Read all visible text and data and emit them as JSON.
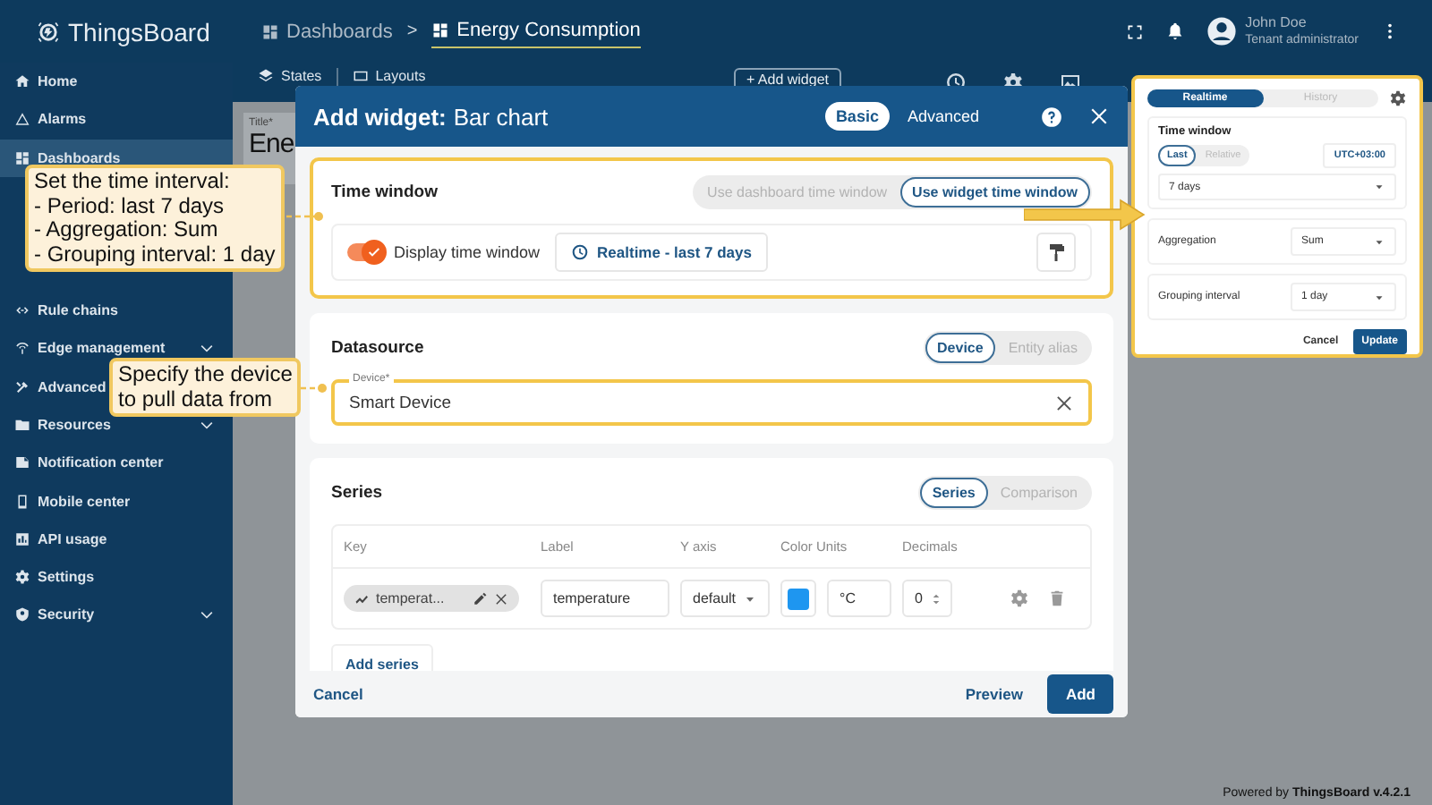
{
  "app": {
    "logo": "ThingsBoard",
    "breadcrumbs": [
      {
        "label": "Dashboards",
        "current": false
      },
      {
        "label": "Energy Consumption",
        "current": true
      }
    ],
    "separator": ">",
    "user": {
      "name": "John Doe",
      "role": "Tenant administrator"
    }
  },
  "sidebar": {
    "items": [
      {
        "label": "Home",
        "selected": false,
        "expandable": false
      },
      {
        "label": "Alarms",
        "selected": false,
        "expandable": false
      },
      {
        "label": "Dashboards",
        "selected": true,
        "expandable": false
      },
      {
        "label": "Rule chains",
        "selected": false,
        "expandable": false
      },
      {
        "label": "Edge management",
        "selected": false,
        "expandable": true
      },
      {
        "label": "Advanced",
        "selected": false,
        "expandable": false
      },
      {
        "label": "Resources",
        "selected": false,
        "expandable": true
      },
      {
        "label": "Notification center",
        "selected": false,
        "expandable": false
      },
      {
        "label": "Mobile center",
        "selected": false,
        "expandable": false
      },
      {
        "label": "API usage",
        "selected": false,
        "expandable": false
      },
      {
        "label": "Settings",
        "selected": false,
        "expandable": false
      },
      {
        "label": "Security",
        "selected": false,
        "expandable": true
      }
    ]
  },
  "toolbar": {
    "items": [
      "States",
      "Layouts"
    ],
    "add_widget": "+ Add widget"
  },
  "dashboard": {
    "title_label": "Title*",
    "title": "Ene"
  },
  "dialog": {
    "title": "Add widget:",
    "widget": "Bar chart",
    "modes": [
      {
        "label": "Basic",
        "selected": true
      },
      {
        "label": "Advanced",
        "selected": false
      }
    ],
    "time_window": {
      "heading": "Time window",
      "highlighted": true,
      "options": [
        {
          "label": "Use dashboard time window",
          "selected": false
        },
        {
          "label": "Use widget time window",
          "selected": true
        }
      ],
      "display_toggle": {
        "label": "Display time window",
        "on": true
      },
      "value": "Realtime - last 7 days"
    },
    "datasource": {
      "heading": "Datasource",
      "options": [
        {
          "label": "Device",
          "selected": true
        },
        {
          "label": "Entity alias",
          "selected": false
        }
      ],
      "device": {
        "label": "Device*",
        "value": "Smart Device",
        "highlighted": true
      }
    },
    "series": {
      "heading": "Series",
      "options": [
        {
          "label": "Series",
          "selected": true
        },
        {
          "label": "Comparison",
          "selected": false
        }
      ],
      "columns": [
        "Key",
        "Label",
        "Y axis",
        "Color",
        "Units",
        "Decimals"
      ],
      "rows": [
        {
          "key": "temperat...",
          "label": "temperature",
          "y_axis": "default",
          "color": "#1e96f0",
          "units": "°C",
          "decimals": "0"
        }
      ],
      "add": "Add series"
    },
    "buttons": {
      "cancel": "Cancel",
      "preview": "Preview",
      "add": "Add"
    }
  },
  "time_popup": {
    "tabs": [
      {
        "label": "Realtime",
        "selected": true
      },
      {
        "label": "History",
        "selected": false
      }
    ],
    "heading": "Time window",
    "modes": [
      {
        "label": "Last",
        "selected": true
      },
      {
        "label": "Relative",
        "selected": false
      }
    ],
    "timezone": "UTC+03:00",
    "period": "7 days",
    "aggregation": {
      "label": "Aggregation",
      "value": "Sum"
    },
    "grouping": {
      "label": "Grouping interval",
      "value": "1 day"
    },
    "cancel": "Cancel",
    "update": "Update"
  },
  "callouts": [
    {
      "lines": [
        "Set the time interval:",
        "- Period: last 7 days",
        "- Aggregation:  Sum",
        "- Grouping interval: 1 day"
      ]
    },
    {
      "lines": [
        "Specify the device",
        "to pull data from"
      ]
    }
  ],
  "footer": {
    "text": "Powered by **ThingsBoard v.4.2.1**"
  }
}
